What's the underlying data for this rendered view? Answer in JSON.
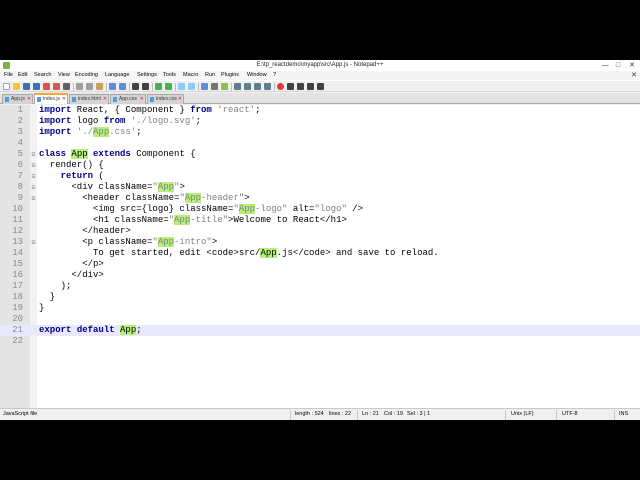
{
  "window": {
    "title": "E:\\tp_reactdemo\\myapp\\src\\App.js - Notepad++",
    "controls": {
      "minimize": "—",
      "maximize": "□",
      "close": "✕"
    }
  },
  "menu": {
    "items": [
      "File",
      "Edit",
      "Search",
      "View",
      "Encoding",
      "Language",
      "Settings",
      "Tools",
      "Macro",
      "Run",
      "Plugins",
      "Window",
      "?"
    ],
    "close": "✕"
  },
  "tabs": [
    {
      "label": "App.js",
      "active": false
    },
    {
      "label": "index.js",
      "active": true
    },
    {
      "label": "index.html",
      "active": false
    },
    {
      "label": "App.css",
      "active": false
    },
    {
      "label": "index.css",
      "active": false
    }
  ],
  "editor": {
    "lines": [
      {
        "n": "1",
        "html": "<span class=\"kw\">import</span> React, { Component } <span class=\"kw\">from</span> <span class=\"str\">'react'</span>;"
      },
      {
        "n": "2",
        "html": "<span class=\"kw\">import</span> logo <span class=\"kw\">from</span> <span class=\"str\">'./logo.svg'</span>;"
      },
      {
        "n": "3",
        "html": "<span class=\"kw\">import</span> <span class=\"str\">'./<span class=\"hl\">App</span>.css'</span>;"
      },
      {
        "n": "4",
        "html": ""
      },
      {
        "n": "5",
        "html": "<span class=\"kw\">class</span> <span class=\"hl\">App</span> <span class=\"kw\">extends</span> Component {"
      },
      {
        "n": "6",
        "html": "  render() {"
      },
      {
        "n": "7",
        "html": "    <span class=\"kw\">return</span> ("
      },
      {
        "n": "8",
        "html": "      &lt;div className=<span class=\"str\">\"<span class=\"hl\">App</span>\"</span>&gt;"
      },
      {
        "n": "9",
        "html": "        &lt;header className=<span class=\"str\">\"<span class=\"hl\">App</span>-header\"</span>&gt;"
      },
      {
        "n": "10",
        "html": "          &lt;img src={logo} className=<span class=\"str\">\"<span class=\"hl\">App</span>-logo\"</span> alt=<span class=\"str\">\"logo\"</span> /&gt;"
      },
      {
        "n": "11",
        "html": "          &lt;h1 className=<span class=\"str\">\"<span class=\"hl\">App</span>-title\"</span>&gt;Welcome to React&lt;/h1&gt;"
      },
      {
        "n": "12",
        "html": "        &lt;/header&gt;"
      },
      {
        "n": "13",
        "html": "        &lt;p className=<span class=\"str\">\"<span class=\"hl\">App</span>-intro\"</span>&gt;"
      },
      {
        "n": "14",
        "html": "          To get started, edit &lt;code&gt;src/<span class=\"hl\">App</span>.js&lt;/code&gt; and save to reload."
      },
      {
        "n": "15",
        "html": "        &lt;/p&gt;"
      },
      {
        "n": "16",
        "html": "      &lt;/div&gt;"
      },
      {
        "n": "17",
        "html": "    );"
      },
      {
        "n": "18",
        "html": "  }"
      },
      {
        "n": "19",
        "html": "}"
      },
      {
        "n": "20",
        "html": ""
      },
      {
        "n": "21",
        "html": "<span class=\"kw\">export</span> <span class=\"kw\">default</span> <span class=\"hl\">App</span>;"
      },
      {
        "n": "22",
        "html": ""
      }
    ],
    "current_line": "21"
  },
  "status": {
    "file_type": "JavaScript file",
    "length": "length : 524",
    "lines": "lines : 22",
    "ln": "Ln : 21",
    "col": "Col : 19",
    "sel": "Sel : 3 | 1",
    "eol": "Unix (LF)",
    "encoding": "UTF-8",
    "mode": "INS"
  },
  "colors": {
    "highlight": "#b4f07a",
    "keyword": "#00008b",
    "string": "#808080",
    "active_tab_accent": "#f9a825"
  }
}
